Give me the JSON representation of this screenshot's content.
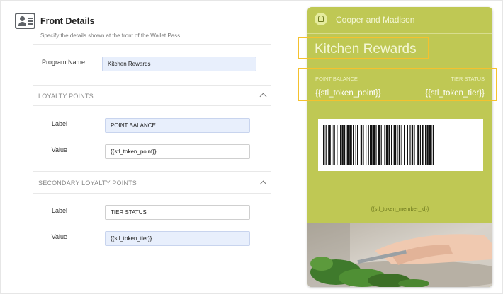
{
  "header": {
    "title": "Front Details",
    "subtitle": "Specify the details shown at the front of the Wallet Pass",
    "icon": "id-card-icon"
  },
  "form": {
    "program_name": {
      "label": "Program Name",
      "value": "Kitchen Rewards"
    },
    "loyalty": {
      "section": "LOYALTY POINTS",
      "label_field": {
        "label": "Label",
        "value": "POINT BALANCE"
      },
      "value_field": {
        "label": "Value",
        "value": "{{stl_token_point}}"
      }
    },
    "secondary": {
      "section": "SECONDARY LOYALTY POINTS",
      "label_field": {
        "label": "Label",
        "value": "TIER STATUS"
      },
      "value_field": {
        "label": "Value",
        "value": "{{stl_token_tier}}"
      }
    }
  },
  "pass": {
    "organization": "Cooper and Madison",
    "program": "Kitchen Rewards",
    "primary_label": "POINT BALANCE",
    "primary_value": "{{stl_token_point}}",
    "secondary_label": "TIER STATUS",
    "secondary_value": "{{stl_token_tier}}",
    "member_id": "{{stl_token_member_id}}",
    "background_color": "#bfc854",
    "logo_icon": "chef-hat-icon"
  },
  "colors": {
    "highlight": "#f5c12e",
    "active_input": "#e8effc"
  }
}
